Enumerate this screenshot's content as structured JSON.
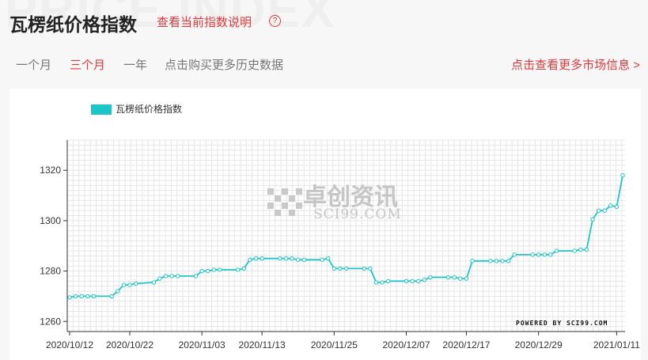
{
  "header": {
    "bg_word": "PRICE INDEX",
    "title": "瓦楞纸价格指数",
    "explain_link": "查看当前指数说明",
    "help_icon_glyph": "?"
  },
  "tabs": [
    {
      "label": "一个月",
      "active": false
    },
    {
      "label": "三个月",
      "active": true
    },
    {
      "label": "一年",
      "active": false
    },
    {
      "label": "点击购买更多历史数据",
      "active": false
    }
  ],
  "more_link": "点击查看更多市场信息 >",
  "colors": {
    "accent": "#e4393c",
    "series": "#1cc6c6"
  },
  "watermark": {
    "cn": "卓创资讯",
    "en": "SCI99.COM",
    "powered": "POWERED BY SCI99.COM"
  },
  "chart_data": {
    "type": "line",
    "title": "",
    "xlabel": "",
    "ylabel": "",
    "legend": {
      "position": "top-left"
    },
    "grid": true,
    "ylim": [
      1256,
      1332
    ],
    "yticks": [
      1260,
      1280,
      1300,
      1320
    ],
    "xtick_labels": [
      "2020/10/12",
      "2020/10/22",
      "2020/11/03",
      "2020/11/13",
      "2020/11/25",
      "2020/12/07",
      "2020/12/17",
      "2020/12/29",
      "2021/01/11"
    ],
    "series": [
      {
        "name": "瓦楞纸价格指数",
        "points": [
          [
            "2020/10/12",
            1269.5
          ],
          [
            "2020/10/13",
            1270
          ],
          [
            "2020/10/14",
            1270
          ],
          [
            "2020/10/15",
            1270
          ],
          [
            "2020/10/16",
            1270
          ],
          [
            "2020/10/19",
            1270
          ],
          [
            "2020/10/20",
            1272
          ],
          [
            "2020/10/21",
            1274.5
          ],
          [
            "2020/10/22",
            1274.5
          ],
          [
            "2020/10/23",
            1275
          ],
          [
            "2020/10/26",
            1275.5
          ],
          [
            "2020/10/27",
            1277
          ],
          [
            "2020/10/28",
            1278
          ],
          [
            "2020/10/29",
            1278
          ],
          [
            "2020/10/30",
            1278
          ],
          [
            "2020/11/02",
            1278
          ],
          [
            "2020/11/03",
            1280
          ],
          [
            "2020/11/04",
            1280
          ],
          [
            "2020/11/05",
            1280.5
          ],
          [
            "2020/11/06",
            1280.5
          ],
          [
            "2020/11/09",
            1280.5
          ],
          [
            "2020/11/10",
            1281
          ],
          [
            "2020/11/11",
            1284.5
          ],
          [
            "2020/11/12",
            1285
          ],
          [
            "2020/11/13",
            1285
          ],
          [
            "2020/11/16",
            1285
          ],
          [
            "2020/11/17",
            1285
          ],
          [
            "2020/11/18",
            1285
          ],
          [
            "2020/11/19",
            1284.5
          ],
          [
            "2020/11/20",
            1284.5
          ],
          [
            "2020/11/23",
            1284.5
          ],
          [
            "2020/11/24",
            1285
          ],
          [
            "2020/11/25",
            1281
          ],
          [
            "2020/11/26",
            1281
          ],
          [
            "2020/11/27",
            1281
          ],
          [
            "2020/11/30",
            1281
          ],
          [
            "2020/12/01",
            1281
          ],
          [
            "2020/12/02",
            1275.5
          ],
          [
            "2020/12/03",
            1275.5
          ],
          [
            "2020/12/04",
            1276
          ],
          [
            "2020/12/07",
            1276
          ],
          [
            "2020/12/08",
            1276
          ],
          [
            "2020/12/09",
            1276
          ],
          [
            "2020/12/10",
            1276.5
          ],
          [
            "2020/12/11",
            1277.5
          ],
          [
            "2020/12/14",
            1277.5
          ],
          [
            "2020/12/15",
            1277.5
          ],
          [
            "2020/12/16",
            1277
          ],
          [
            "2020/12/17",
            1277
          ],
          [
            "2020/12/18",
            1284
          ],
          [
            "2020/12/21",
            1284
          ],
          [
            "2020/12/22",
            1284
          ],
          [
            "2020/12/23",
            1284
          ],
          [
            "2020/12/24",
            1284
          ],
          [
            "2020/12/25",
            1286.5
          ],
          [
            "2020/12/28",
            1286.5
          ],
          [
            "2020/12/29",
            1286.5
          ],
          [
            "2020/12/30",
            1286.5
          ],
          [
            "2020/12/31",
            1286.5
          ],
          [
            "2021/01/01",
            1288
          ],
          [
            "2021/01/04",
            1288
          ],
          [
            "2021/01/05",
            1288.5
          ],
          [
            "2021/01/06",
            1288.5
          ],
          [
            "2021/01/07",
            1300.5
          ],
          [
            "2021/01/08",
            1304
          ],
          [
            "2021/01/09",
            1304
          ],
          [
            "2021/01/10",
            1306
          ],
          [
            "2021/01/11",
            1305.5
          ],
          [
            "2021/01/12",
            1318
          ]
        ]
      }
    ]
  }
}
